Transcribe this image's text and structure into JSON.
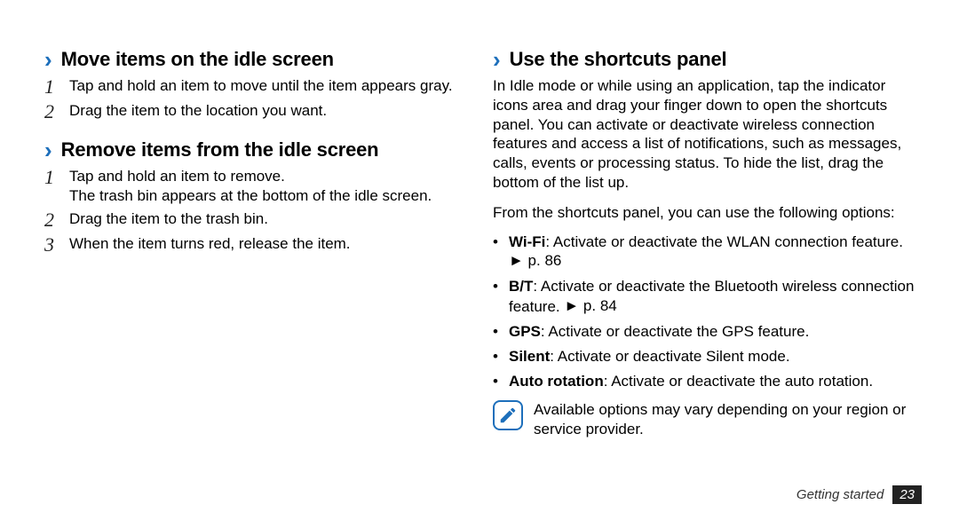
{
  "left": {
    "sections": [
      {
        "title": "Move items on the idle screen",
        "steps": [
          "Tap and hold an item to move until the item appears gray.",
          "Drag the item to the location you want."
        ]
      },
      {
        "title": "Remove items from the idle screen",
        "steps": [
          "Tap and hold an item to remove.\nThe trash bin appears at the bottom of the idle screen.",
          "Drag the item to the trash bin.",
          "When the item turns red, release the item."
        ]
      }
    ]
  },
  "right": {
    "title": "Use the shortcuts panel",
    "intro": "In Idle mode or while using an application, tap the indicator icons area and drag your finger down to open the shortcuts panel. You can activate or deactivate wireless connection features and access a list of notifications, such as messages, calls, events or processing status. To hide the list, drag the bottom of the list up.",
    "lead": "From the shortcuts panel, you can use the following options:",
    "options": [
      {
        "label": "Wi-Fi",
        "desc": ": Activate or deactivate the WLAN connection feature. ",
        "ref": "► p. 86"
      },
      {
        "label": "B/T",
        "desc": ": Activate or deactivate the Bluetooth wireless connection feature. ",
        "ref": "► p. 84"
      },
      {
        "label": "GPS",
        "desc": ": Activate or deactivate the GPS feature.",
        "ref": ""
      },
      {
        "label": "Silent",
        "desc": ": Activate or deactivate Silent mode.",
        "ref": ""
      },
      {
        "label": "Auto rotation",
        "desc": ": Activate or deactivate the auto rotation.",
        "ref": ""
      }
    ],
    "note": "Available options may vary depending on your region or service provider."
  },
  "footer": {
    "section": "Getting started",
    "page": "23"
  },
  "numerals": [
    "1",
    "2",
    "3"
  ]
}
